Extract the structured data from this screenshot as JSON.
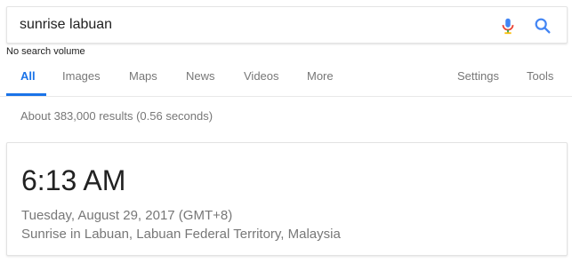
{
  "search": {
    "query": "sunrise labuan",
    "volume_note": "No search volume",
    "mic_icon": "microphone-icon",
    "search_icon": "magnifier-icon"
  },
  "tabs": [
    {
      "label": "All",
      "active": true
    },
    {
      "label": "Images",
      "active": false
    },
    {
      "label": "Maps",
      "active": false
    },
    {
      "label": "News",
      "active": false
    },
    {
      "label": "Videos",
      "active": false
    },
    {
      "label": "More",
      "active": false
    },
    {
      "label": "Settings",
      "active": false
    },
    {
      "label": "Tools",
      "active": false
    }
  ],
  "results": {
    "stats": "About 383,000 results (0.56 seconds)"
  },
  "answer_card": {
    "time": "6:13 AM",
    "date": "Tuesday, August 29, 2017 (GMT+8)",
    "description": "Sunrise in Labuan, Labuan Federal Territory, Malaysia"
  },
  "colors": {
    "accent": "#1a73e8",
    "mic_blue": "#4285f4",
    "mic_red": "#ea4335",
    "mic_yellow": "#fbbc05",
    "mic_green": "#34a853",
    "muted_text": "#777777"
  }
}
